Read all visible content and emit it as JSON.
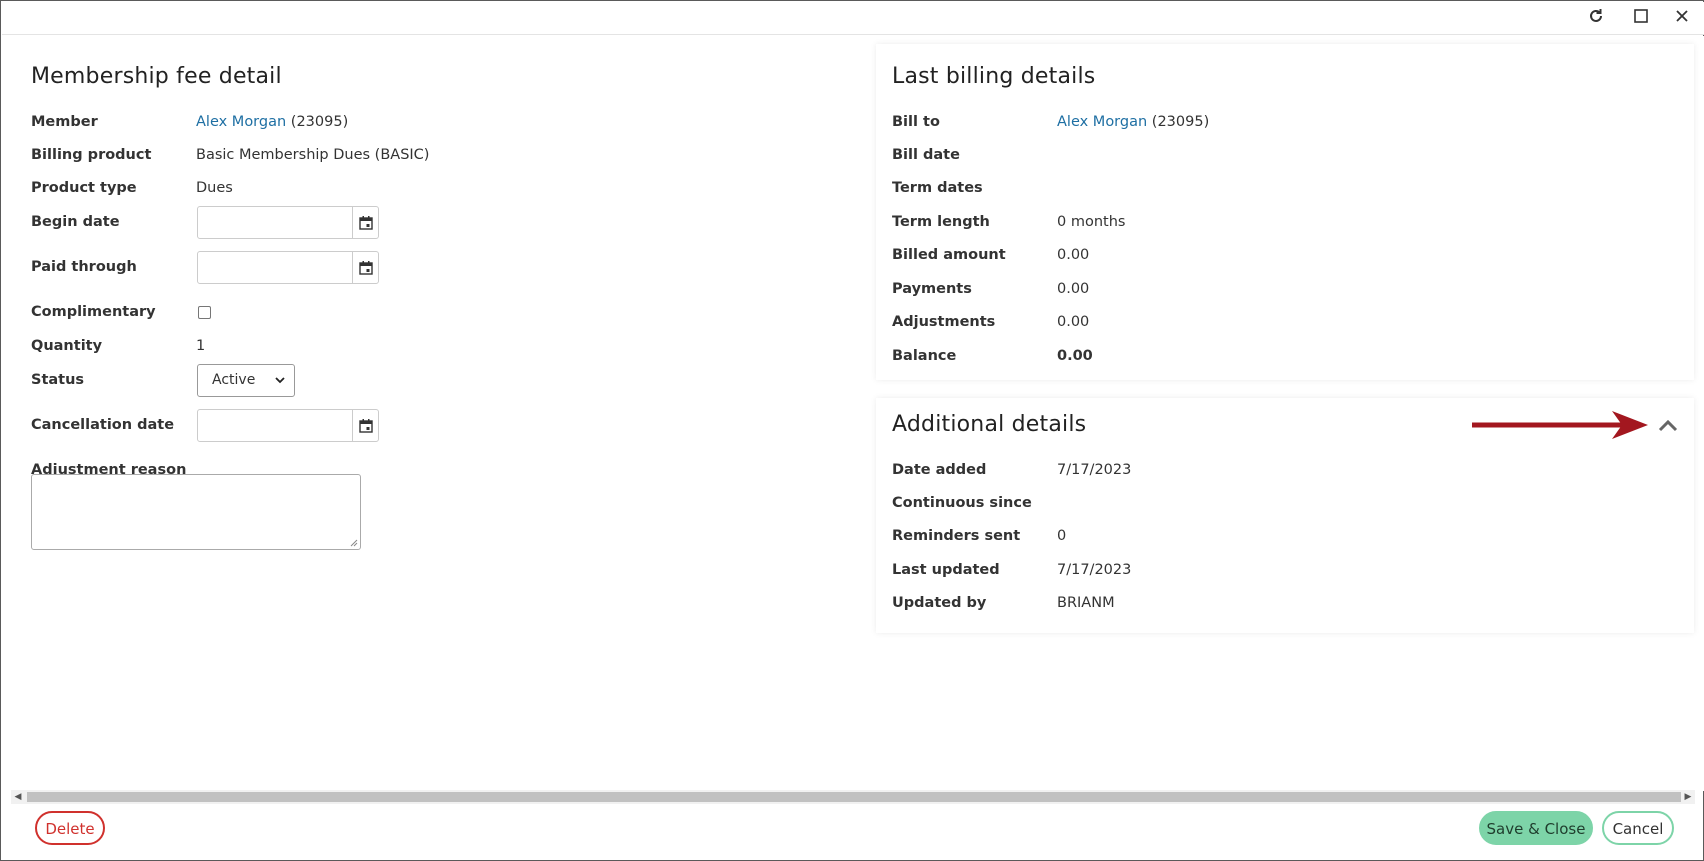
{
  "window": {
    "refresh_icon": "refresh-icon",
    "maximize_icon": "maximize-icon",
    "close_icon": "close-icon"
  },
  "fee_detail": {
    "title": "Membership fee detail",
    "member_label": "Member",
    "member_name": "Alex Morgan",
    "member_id": "(23095)",
    "billing_product_label": "Billing product",
    "billing_product_value": "Basic Membership Dues (BASIC)",
    "product_type_label": "Product type",
    "product_type_value": "Dues",
    "begin_date_label": "Begin date",
    "begin_date_value": "",
    "paid_through_label": "Paid through",
    "paid_through_value": "",
    "complimentary_label": "Complimentary",
    "complimentary_checked": false,
    "quantity_label": "Quantity",
    "quantity_value": "1",
    "status_label": "Status",
    "status_value": "Active",
    "cancellation_date_label": "Cancellation date",
    "cancellation_date_value": "",
    "adjustment_reason_label": "Adjustment reason",
    "adjustment_reason_value": ""
  },
  "last_billing": {
    "title": "Last billing details",
    "bill_to_label": "Bill to",
    "bill_to_name": "Alex Morgan",
    "bill_to_id": "(23095)",
    "bill_date_label": "Bill date",
    "bill_date_value": "",
    "term_dates_label": "Term dates",
    "term_dates_value": "",
    "term_length_label": "Term length",
    "term_length_value": "0 months",
    "billed_amount_label": "Billed amount",
    "billed_amount_value": "0.00",
    "payments_label": "Payments",
    "payments_value": "0.00",
    "adjustments_label": "Adjustments",
    "adjustments_value": "0.00",
    "balance_label": "Balance",
    "balance_value": "0.00"
  },
  "additional": {
    "title": "Additional details",
    "date_added_label": "Date added",
    "date_added_value": "7/17/2023",
    "continuous_since_label": "Continuous since",
    "continuous_since_value": "",
    "reminders_sent_label": "Reminders sent",
    "reminders_sent_value": "0",
    "last_updated_label": "Last updated",
    "last_updated_value": "7/17/2023",
    "updated_by_label": "Updated by",
    "updated_by_value": "BRIANM"
  },
  "annotation": {
    "arrow_color": "#a3171f"
  },
  "footer": {
    "delete_label": "Delete",
    "save_close_label": "Save & Close",
    "cancel_label": "Cancel"
  },
  "colors": {
    "link": "#1e6fa3",
    "delete": "#d0312d",
    "save": "#7dd4a8"
  }
}
